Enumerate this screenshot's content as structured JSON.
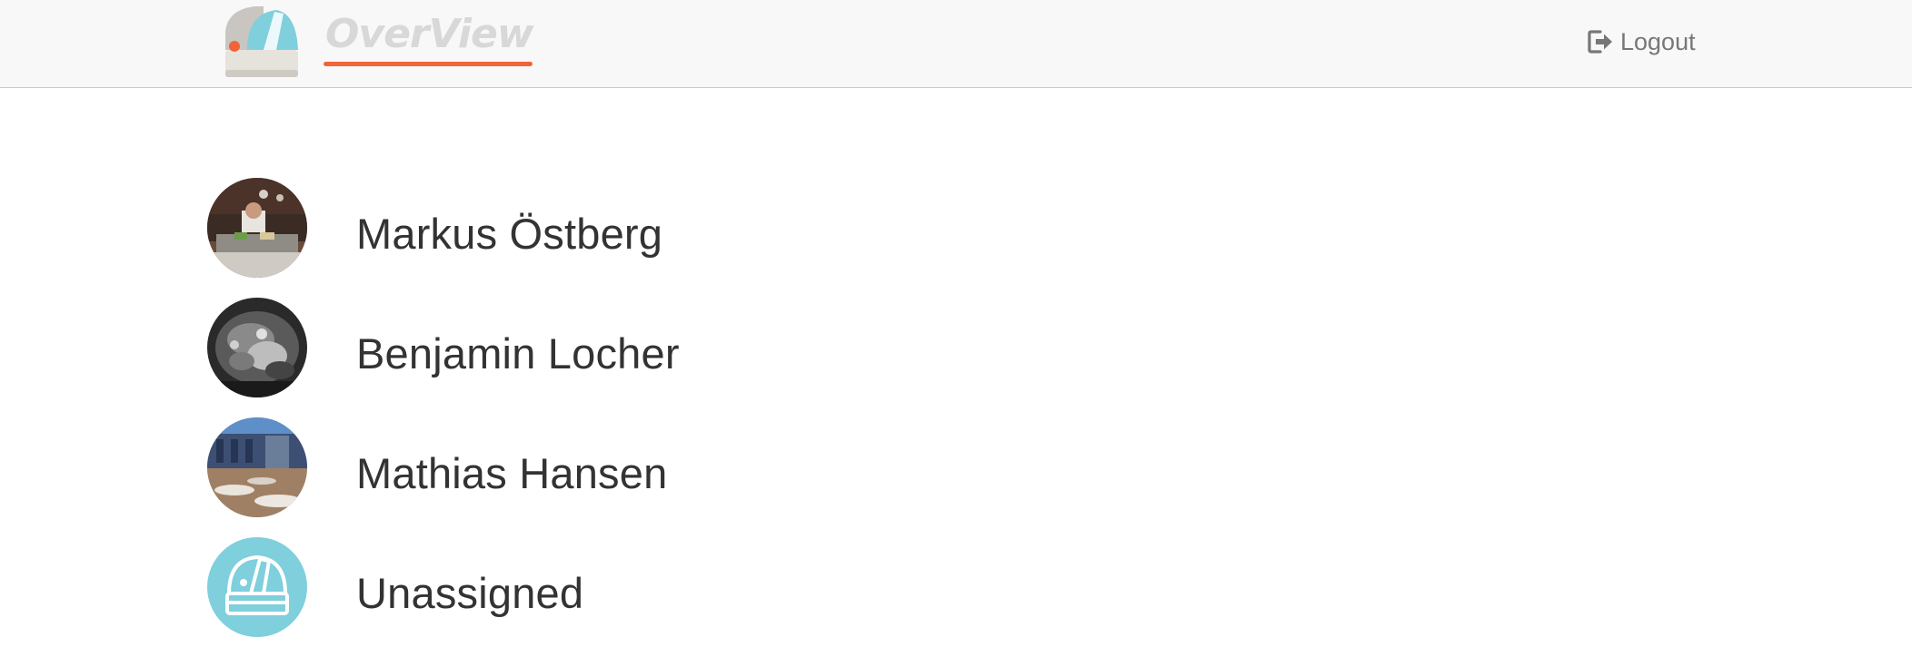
{
  "header": {
    "brand_name": "OverView",
    "logout_label": "Logout"
  },
  "users": [
    {
      "name": "Markus Östberg",
      "avatar": "photo-chef"
    },
    {
      "name": "Benjamin Locher",
      "avatar": "photo-dog-bw"
    },
    {
      "name": "Mathias Hansen",
      "avatar": "photo-building"
    },
    {
      "name": "Unassigned",
      "avatar": "observatory-icon"
    }
  ],
  "colors": {
    "accent_orange": "#f0643a",
    "logo_blue": "#7fcfdd",
    "unassigned_bg": "#7fcfdd",
    "text_dark": "#333333",
    "text_muted": "#777777"
  }
}
